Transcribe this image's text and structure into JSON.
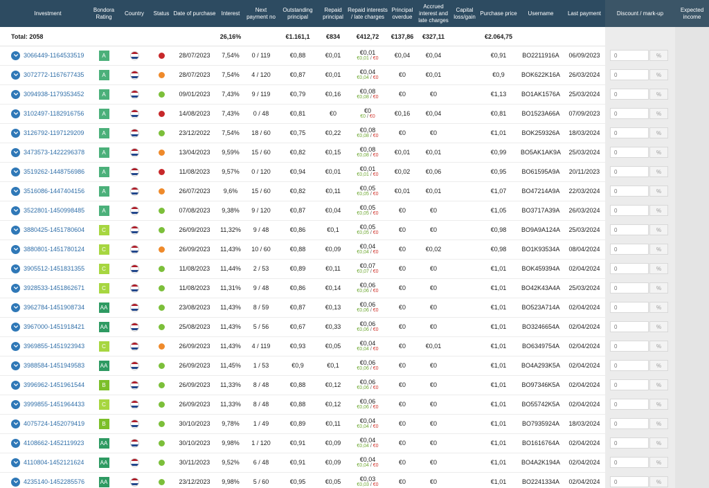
{
  "colors": {
    "header_bg": "#2d4b61",
    "link": "#2f6ea8",
    "green": "#6ea832",
    "red": "#d0342c",
    "status_green": "#7cbf3a",
    "status_orange": "#ef8a2b",
    "status_red": "#c7282a",
    "rating_A": "#4bb07a",
    "rating_AA": "#2e9a62",
    "rating_B": "#7cbf2a",
    "rating_C": "#a7d640"
  },
  "headers": {
    "investment": "Investment",
    "rating": "Bondora Rating",
    "country": "Country",
    "status": "Status",
    "date": "Date of purchase",
    "interest": "Interest",
    "next_payment": "Next payment no",
    "outstanding": "Outstanding principal",
    "repaid_principal": "Repaid principal",
    "repaid_interests": "Repaid interests / late charges",
    "overdue": "Principal overdue",
    "accrued": "Accrued interest and late charges",
    "capital": "Capital loss/gain",
    "price": "Purchase price",
    "username": "Username",
    "last_payment": "Last payment",
    "discount": "Discount / mark-up",
    "expected": "Expected income"
  },
  "totals": {
    "label": "Total: 2058",
    "interest": "26,16%",
    "outstanding": "€1.161,1",
    "repaid_principal": "€834",
    "repaid_interests": "€412,72",
    "overdue": "€137,86",
    "accrued": "€327,11",
    "price": "€2.064,75"
  },
  "input": {
    "placeholder": "0",
    "unit": "%"
  },
  "rows": [
    {
      "id": "3066449-1164533519",
      "rating": "A",
      "status": "red",
      "date": "28/07/2023",
      "interest": "7,54%",
      "next": "0 / 119",
      "outstanding": "€0,88",
      "repaid": "€0,01",
      "ri": "€0,01",
      "ri_a": "€0,01",
      "ri_b": "€0",
      "overdue": "€0,04",
      "accrued": "€0,04",
      "price": "€0,91",
      "user": "BO2211916A",
      "last": "06/09/2023"
    },
    {
      "id": "3072772-1167677435",
      "rating": "A",
      "status": "orange",
      "date": "28/07/2023",
      "interest": "7,54%",
      "next": "4 / 120",
      "outstanding": "€0,87",
      "repaid": "€0,01",
      "ri": "€0,04",
      "ri_a": "€0,04",
      "ri_b": "€0",
      "overdue": "€0",
      "accrued": "€0,01",
      "price": "€0,9",
      "user": "BOK622K16A",
      "last": "26/03/2024"
    },
    {
      "id": "3094938-1179353452",
      "rating": "A",
      "status": "green",
      "date": "09/01/2023",
      "interest": "7,43%",
      "next": "9 / 119",
      "outstanding": "€0,79",
      "repaid": "€0,16",
      "ri": "€0,08",
      "ri_a": "€0,08",
      "ri_b": "€0",
      "overdue": "€0",
      "accrued": "€0",
      "price": "€1,13",
      "user": "BO1AK1576A",
      "last": "25/03/2024"
    },
    {
      "id": "3102497-1182916756",
      "rating": "A",
      "status": "red",
      "date": "14/08/2023",
      "interest": "7,43%",
      "next": "0 / 48",
      "outstanding": "€0,81",
      "repaid": "€0",
      "ri": "€0",
      "ri_a": "€0",
      "ri_b": "€0",
      "overdue": "€0,16",
      "accrued": "€0,04",
      "price": "€0,81",
      "user": "BO1523A66A",
      "last": "07/09/2023"
    },
    {
      "id": "3126792-1197129209",
      "rating": "A",
      "status": "green",
      "date": "23/12/2022",
      "interest": "7,54%",
      "next": "18 / 60",
      "outstanding": "€0,75",
      "repaid": "€0,22",
      "ri": "€0,08",
      "ri_a": "€0,08",
      "ri_b": "€0",
      "overdue": "€0",
      "accrued": "€0",
      "price": "€1,01",
      "user": "BOK259326A",
      "last": "18/03/2024"
    },
    {
      "id": "3473573-1422296378",
      "rating": "A",
      "status": "orange",
      "date": "13/04/2023",
      "interest": "9,59%",
      "next": "15 / 60",
      "outstanding": "€0,82",
      "repaid": "€0,15",
      "ri": "€0,08",
      "ri_a": "€0,08",
      "ri_b": "€0",
      "overdue": "€0,01",
      "accrued": "€0,01",
      "price": "€0,99",
      "user": "BO5AK1AK9A",
      "last": "25/03/2024"
    },
    {
      "id": "3519262-1448756986",
      "rating": "A",
      "status": "red",
      "date": "11/08/2023",
      "interest": "9,57%",
      "next": "0 / 120",
      "outstanding": "€0,94",
      "repaid": "€0,01",
      "ri": "€0,01",
      "ri_a": "€0,01",
      "ri_b": "€0",
      "overdue": "€0,02",
      "accrued": "€0,06",
      "price": "€0,95",
      "user": "BO61595A9A",
      "last": "20/11/2023"
    },
    {
      "id": "3516086-1447404156",
      "rating": "A",
      "status": "orange",
      "date": "26/07/2023",
      "interest": "9,6%",
      "next": "15 / 60",
      "outstanding": "€0,82",
      "repaid": "€0,11",
      "ri": "€0,05",
      "ri_a": "€0,05",
      "ri_b": "€0",
      "overdue": "€0,01",
      "accrued": "€0,01",
      "price": "€1,07",
      "user": "BO47214A9A",
      "last": "22/03/2024"
    },
    {
      "id": "3522801-1450998485",
      "rating": "A",
      "status": "green",
      "date": "07/08/2023",
      "interest": "9,38%",
      "next": "9 / 120",
      "outstanding": "€0,87",
      "repaid": "€0,04",
      "ri": "€0,05",
      "ri_a": "€0,05",
      "ri_b": "€0",
      "overdue": "€0",
      "accrued": "€0",
      "price": "€1,05",
      "user": "BO3717A39A",
      "last": "26/03/2024"
    },
    {
      "id": "3880425-1451780604",
      "rating": "C",
      "status": "green",
      "date": "26/09/2023",
      "interest": "11,32%",
      "next": "9 / 48",
      "outstanding": "€0,86",
      "repaid": "€0,1",
      "ri": "€0,05",
      "ri_a": "€0,05",
      "ri_b": "€0",
      "overdue": "€0",
      "accrued": "€0",
      "price": "€0,98",
      "user": "BO9A9A124A",
      "last": "25/03/2024"
    },
    {
      "id": "3880801-1451780124",
      "rating": "C",
      "status": "orange",
      "date": "26/09/2023",
      "interest": "11,43%",
      "next": "10 / 60",
      "outstanding": "€0,88",
      "repaid": "€0,09",
      "ri": "€0,04",
      "ri_a": "€0,04",
      "ri_b": "€0",
      "overdue": "€0",
      "accrued": "€0,02",
      "price": "€0,98",
      "user": "BO1K93534A",
      "last": "08/04/2024"
    },
    {
      "id": "3905512-1451831355",
      "rating": "C",
      "status": "green",
      "date": "11/08/2023",
      "interest": "11,44%",
      "next": "2 / 53",
      "outstanding": "€0,89",
      "repaid": "€0,11",
      "ri": "€0,07",
      "ri_a": "€0,07",
      "ri_b": "€0",
      "overdue": "€0",
      "accrued": "€0",
      "price": "€1,01",
      "user": "BOK459394A",
      "last": "02/04/2024"
    },
    {
      "id": "3928533-1451862671",
      "rating": "C",
      "status": "green",
      "date": "11/08/2023",
      "interest": "11,31%",
      "next": "9 / 48",
      "outstanding": "€0,86",
      "repaid": "€0,14",
      "ri": "€0,06",
      "ri_a": "€0,06",
      "ri_b": "€0",
      "overdue": "€0",
      "accrued": "€0",
      "price": "€1,01",
      "user": "BO42K43A4A",
      "last": "25/03/2024"
    },
    {
      "id": "3962784-1451908734",
      "rating": "AA",
      "status": "green",
      "date": "23/08/2023",
      "interest": "11,43%",
      "next": "8 / 59",
      "outstanding": "€0,87",
      "repaid": "€0,13",
      "ri": "€0,06",
      "ri_a": "€0,06",
      "ri_b": "€0",
      "overdue": "€0",
      "accrued": "€0",
      "price": "€1,01",
      "user": "BO523A714A",
      "last": "02/04/2024"
    },
    {
      "id": "3967000-1451918421",
      "rating": "AA",
      "status": "green",
      "date": "25/08/2023",
      "interest": "11,43%",
      "next": "5 / 56",
      "outstanding": "€0,67",
      "repaid": "€0,33",
      "ri": "€0,06",
      "ri_a": "€0,06",
      "ri_b": "€0",
      "overdue": "€0",
      "accrued": "€0",
      "price": "€1,01",
      "user": "BO3246654A",
      "last": "02/04/2024"
    },
    {
      "id": "3969855-1451923943",
      "rating": "C",
      "status": "orange",
      "date": "26/09/2023",
      "interest": "11,43%",
      "next": "4 / 119",
      "outstanding": "€0,93",
      "repaid": "€0,05",
      "ri": "€0,04",
      "ri_a": "€0,04",
      "ri_b": "€0",
      "overdue": "€0",
      "accrued": "€0,01",
      "price": "€1,01",
      "user": "BO6349754A",
      "last": "02/04/2024"
    },
    {
      "id": "3988584-1451949583",
      "rating": "AA",
      "status": "green",
      "date": "26/09/2023",
      "interest": "11,45%",
      "next": "1 / 53",
      "outstanding": "€0,9",
      "repaid": "€0,1",
      "ri": "€0,06",
      "ri_a": "€0,06",
      "ri_b": "€0",
      "overdue": "€0",
      "accrued": "€0",
      "price": "€1,01",
      "user": "BO4A293K5A",
      "last": "02/04/2024"
    },
    {
      "id": "3996962-1451961544",
      "rating": "B",
      "status": "green",
      "date": "26/09/2023",
      "interest": "11,33%",
      "next": "8 / 48",
      "outstanding": "€0,88",
      "repaid": "€0,12",
      "ri": "€0,06",
      "ri_a": "€0,06",
      "ri_b": "€0",
      "overdue": "€0",
      "accrued": "€0",
      "price": "€1,01",
      "user": "BO97346K5A",
      "last": "02/04/2024"
    },
    {
      "id": "3999855-1451964433",
      "rating": "C",
      "status": "green",
      "date": "26/09/2023",
      "interest": "11,33%",
      "next": "8 / 48",
      "outstanding": "€0,88",
      "repaid": "€0,12",
      "ri": "€0,06",
      "ri_a": "€0,06",
      "ri_b": "€0",
      "overdue": "€0",
      "accrued": "€0",
      "price": "€1,01",
      "user": "BO55742K5A",
      "last": "02/04/2024"
    },
    {
      "id": "4075724-1452079419",
      "rating": "B",
      "status": "green",
      "date": "30/10/2023",
      "interest": "9,78%",
      "next": "1 / 49",
      "outstanding": "€0,89",
      "repaid": "€0,11",
      "ri": "€0,04",
      "ri_a": "€0,04",
      "ri_b": "€0",
      "overdue": "€0",
      "accrued": "€0",
      "price": "€1,01",
      "user": "BO7935924A",
      "last": "18/03/2024"
    },
    {
      "id": "4108662-1452119923",
      "rating": "AA",
      "status": "green",
      "date": "30/10/2023",
      "interest": "9,98%",
      "next": "1 / 120",
      "outstanding": "€0,91",
      "repaid": "€0,09",
      "ri": "€0,04",
      "ri_a": "€0,04",
      "ri_b": "€0",
      "overdue": "€0",
      "accrued": "€0",
      "price": "€1,01",
      "user": "BO1616764A",
      "last": "02/04/2024"
    },
    {
      "id": "4110804-1452121624",
      "rating": "AA",
      "status": "green",
      "date": "30/11/2023",
      "interest": "9,52%",
      "next": "6 / 48",
      "outstanding": "€0,91",
      "repaid": "€0,09",
      "ri": "€0,04",
      "ri_a": "€0,04",
      "ri_b": "€0",
      "overdue": "€0",
      "accrued": "€0",
      "price": "€1,01",
      "user": "BO4A2K194A",
      "last": "02/04/2024"
    },
    {
      "id": "4235140-1452285576",
      "rating": "AA",
      "status": "green",
      "date": "23/12/2023",
      "interest": "9,98%",
      "next": "5 / 60",
      "outstanding": "€0,95",
      "repaid": "€0,05",
      "ri": "€0,03",
      "ri_a": "€0,03",
      "ri_b": "€0",
      "overdue": "€0",
      "accrued": "€0",
      "price": "€1,01",
      "user": "BO2241334A",
      "last": "02/04/2024"
    }
  ]
}
